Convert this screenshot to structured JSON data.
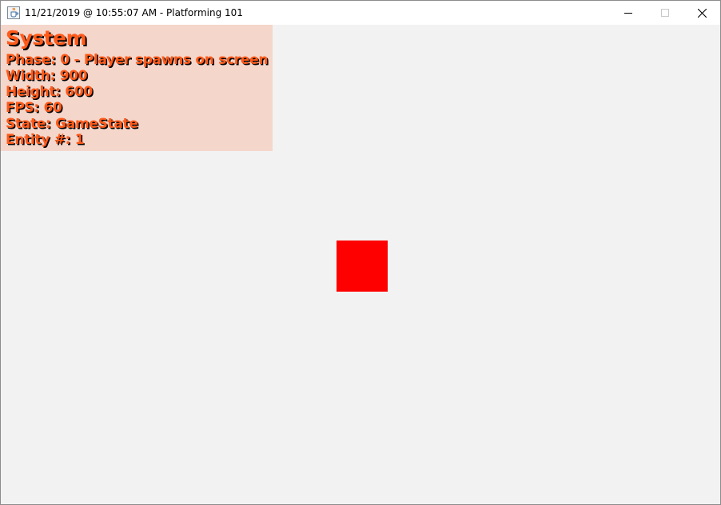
{
  "window": {
    "title": "11/21/2019 @ 10:55:07 AM - Platforming 101",
    "icon": "java-coffee-icon",
    "controls": [
      "minimize-icon",
      "maximize-icon",
      "close-icon"
    ]
  },
  "debug": {
    "heading": "System",
    "lines": [
      "Phase: 0 - Player spawns on screen",
      "Width: 900",
      "Height: 600",
      "FPS: 60",
      "State: GameState",
      "Entity #: 1"
    ],
    "text_color": "#ff5a1a",
    "panel_color": "#f5d6cb"
  },
  "player": {
    "color": "#ff0000"
  },
  "colors": {
    "canvas": "#f2f2f2"
  }
}
